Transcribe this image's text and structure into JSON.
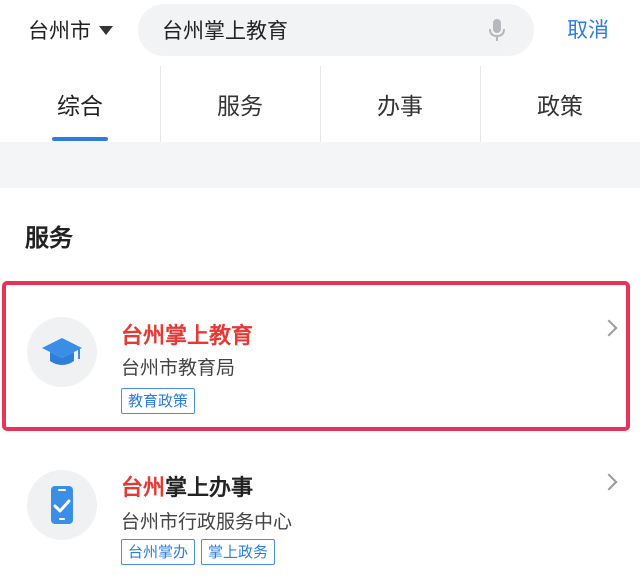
{
  "header": {
    "city": "台州市",
    "search_value": "台州掌上教育",
    "cancel_label": "取消"
  },
  "tabs": [
    {
      "label": "综合",
      "active": true
    },
    {
      "label": "服务",
      "active": false
    },
    {
      "label": "办事",
      "active": false
    },
    {
      "label": "政策",
      "active": false
    }
  ],
  "section": {
    "title": "服务"
  },
  "results": [
    {
      "title_highlight": "台州掌上教育",
      "title_rest": "",
      "subtitle": "台州市教育局",
      "tags": [
        "教育政策"
      ],
      "icon": "graduation-cap-icon",
      "highlighted": true
    },
    {
      "title_highlight": "台州",
      "title_rest": "掌上办事",
      "subtitle": "台州市行政服务中心",
      "tags": [
        "台州掌办",
        "掌上政务"
      ],
      "icon": "mobile-check-icon",
      "highlighted": false
    }
  ],
  "colors": {
    "accent": "#2d7ce0",
    "highlight_text": "#e53935",
    "highlight_border": "#e8325a"
  }
}
